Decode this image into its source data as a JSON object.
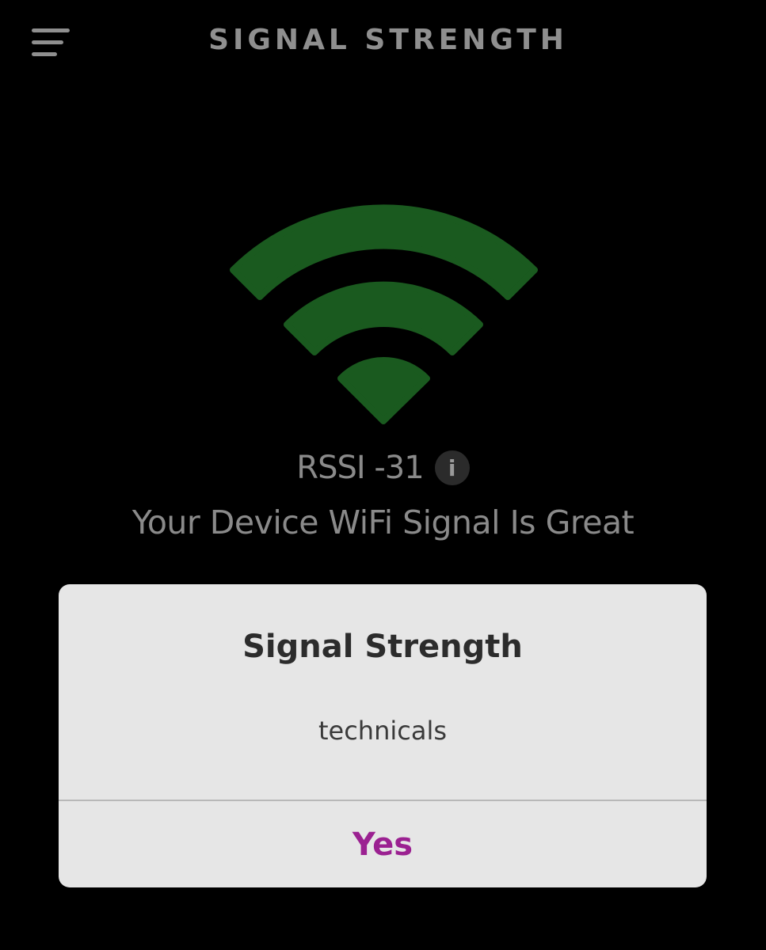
{
  "header": {
    "title": "SIGNAL STRENGTH",
    "menu_icon": "hamburger-menu-icon"
  },
  "signal": {
    "icon": "wifi-icon",
    "icon_color": "#1a5a1f",
    "rssi_label": "RSSI -31",
    "info_glyph": "i",
    "status": "Your Device WiFi Signal Is Great"
  },
  "dialog": {
    "title": "Signal Strength",
    "message": "technicals",
    "confirm_label": "Yes",
    "confirm_color": "#9b2191"
  }
}
